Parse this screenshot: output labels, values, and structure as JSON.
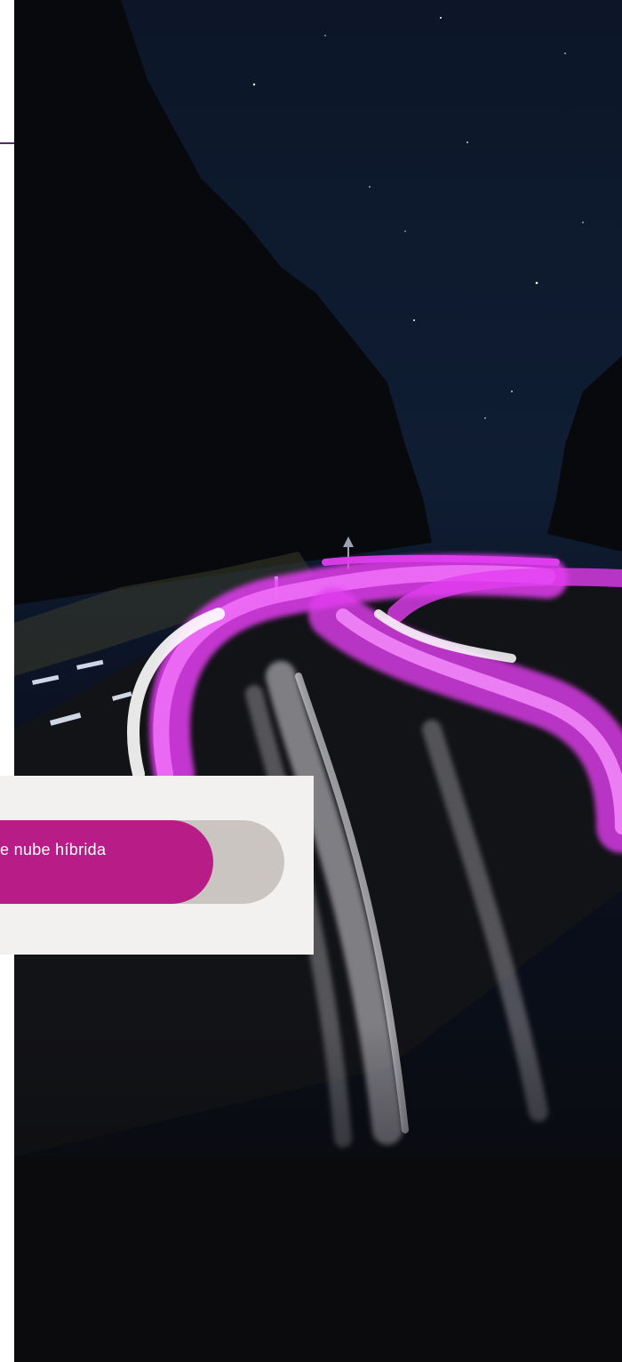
{
  "hero": {
    "image": "night-road-light-trails",
    "colors": {
      "sky": "#0e1a2c",
      "ground": "#0b0b0e",
      "trail_magenta": "#e23df0",
      "trail_white": "#e9e4ef"
    }
  },
  "card": {
    "button_label": "e nube híbrida",
    "colors": {
      "background": "#f3f1ef",
      "track": "#cbc5c1",
      "button": "#b81c86",
      "text": "#ffffff"
    }
  },
  "accent": "#4b2a6d"
}
